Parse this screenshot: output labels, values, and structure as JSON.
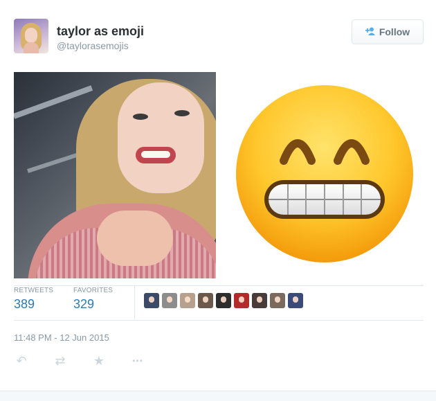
{
  "header": {
    "display_name": "taylor as emoji",
    "handle": "@taylorasemojis",
    "follow_label": "Follow"
  },
  "stats": {
    "retweets_label": "RETWEETS",
    "retweets_value": "389",
    "favorites_label": "FAVORITES",
    "favorites_value": "329"
  },
  "favoriters": [
    {
      "color": "#3b4a66"
    },
    {
      "color": "#8c8c8c"
    },
    {
      "color": "#b7a08e"
    },
    {
      "color": "#6b5a4c"
    },
    {
      "color": "#2d2d2d"
    },
    {
      "color": "#b22a2a"
    },
    {
      "color": "#4a3b3b"
    },
    {
      "color": "#7b6a5e"
    },
    {
      "color": "#3a4b78"
    }
  ],
  "timestamp": "11:48 PM - 12 Jun 2015",
  "actions": [
    {
      "name": "reply-icon",
      "glyph": "↶"
    },
    {
      "name": "retweet-icon",
      "glyph": "⇄"
    },
    {
      "name": "favorite-icon",
      "glyph": "★"
    },
    {
      "name": "more-icon",
      "glyph": "•••"
    }
  ],
  "colors": {
    "accent": "#55acee",
    "stat_value": "#2b7bb9",
    "muted": "#8899a6"
  }
}
